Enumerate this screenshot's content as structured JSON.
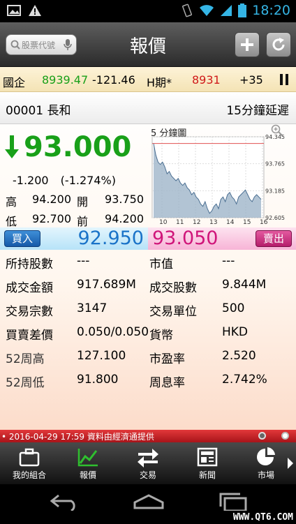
{
  "status_bar": {
    "time": "18:20"
  },
  "header": {
    "title": "報價",
    "search_placeholder": "股票代號"
  },
  "index_ticker": {
    "name": "國企",
    "value": "8939.47",
    "change": "-121.46",
    "futures_label": "H期*",
    "futures_value": "8931",
    "futures_change": "+35"
  },
  "stock": {
    "code_name": "00001 長和",
    "delay": "15分鐘延遲",
    "price": "93.000",
    "direction": "down",
    "change": "-1.200",
    "change_pct": "(-1.274%)",
    "high_label": "高",
    "high": "94.200",
    "open_label": "開",
    "open": "93.750",
    "low_label": "低",
    "low": "92.700",
    "prev_label": "前",
    "prev": "94.200"
  },
  "chart_data": {
    "type": "line",
    "title": "5 分鐘圖",
    "ylim": [
      92.605,
      94.345
    ],
    "y_ticks": [
      "94.345",
      "93.765",
      "93.185",
      "92.605"
    ],
    "x_ticks": [
      "10",
      "11",
      "12",
      "13",
      "14",
      "15",
      "16"
    ],
    "reference_lines": [
      94.2
    ],
    "values": [
      94.2,
      93.95,
      93.8,
      93.75,
      93.8,
      93.7,
      93.55,
      93.6,
      93.5,
      93.45,
      93.4,
      93.45,
      93.35,
      93.3,
      93.35,
      93.25,
      93.2,
      93.1,
      93.15,
      93.05,
      93.0,
      92.9,
      92.85,
      92.95,
      92.8,
      92.7,
      92.75,
      92.85,
      92.9,
      92.8,
      93.0,
      93.05,
      92.95,
      93.1,
      93.15,
      93.05,
      93.0,
      92.9,
      93.05,
      93.1,
      93.15,
      93.2,
      93.1,
      93.0,
      92.95,
      93.05,
      93.1,
      93.05,
      93.0
    ]
  },
  "quote": {
    "buy_label": "買入",
    "bid": "92.950",
    "ask": "93.050",
    "sell_label": "賣出"
  },
  "stats": [
    {
      "label": "所持股數",
      "value": "---",
      "label2": "市值",
      "value2": "---"
    },
    {
      "label": "成交金額",
      "value": "917.689M",
      "label2": "成交股數",
      "value2": "9.844M"
    },
    {
      "label": "交易宗數",
      "value": "3147",
      "label2": "交易單位",
      "value2": "500"
    },
    {
      "label": "買賣差價",
      "value": "0.050/0.050",
      "label2": "貨幣",
      "value2": "HKD"
    },
    {
      "label": "52周高",
      "value": "127.100",
      "label2": "市盈率",
      "value2": "2.520"
    },
    {
      "label": "52周低",
      "value": "91.800",
      "label2": "周息率",
      "value2": "2.742%"
    }
  ],
  "footer": {
    "text": "• 2016-04-29 17:59   資料由經濟通提供"
  },
  "tabs": [
    {
      "label": "我的組合",
      "icon": "briefcase-icon"
    },
    {
      "label": "報價",
      "icon": "chart-line-icon"
    },
    {
      "label": "交易",
      "icon": "exchange-icon"
    },
    {
      "label": "新聞",
      "icon": "newspaper-icon"
    },
    {
      "label": "市場",
      "icon": "pie-chart-icon"
    }
  ],
  "watermark": "WWW.QT6.COM",
  "colors": {
    "down_green": "#19a019",
    "bid_blue": "#1a73c8",
    "ask_pink": "#d0157a",
    "accent_status": "#35b5e5"
  }
}
